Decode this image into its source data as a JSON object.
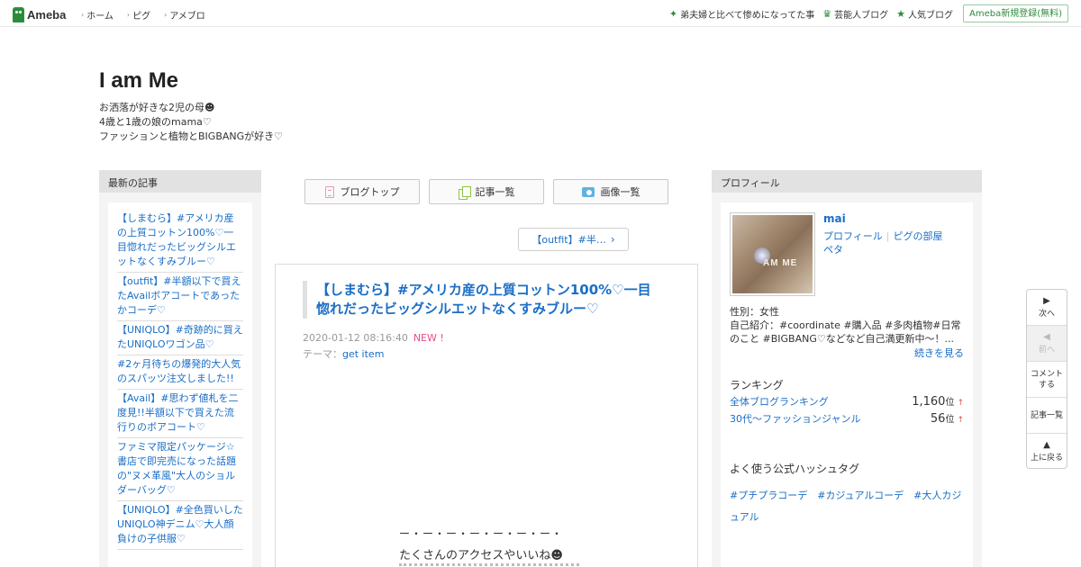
{
  "topbar": {
    "logo_text": "Ameba",
    "links": [
      "ホーム",
      "ピグ",
      "アメブロ"
    ],
    "right_links": [
      {
        "icon": "sparkle-icon",
        "label": "弟夫婦と比べて惨めになってた事"
      },
      {
        "icon": "crown-icon",
        "label": "芸能人ブログ"
      },
      {
        "icon": "star-icon",
        "label": "人気ブログ"
      }
    ],
    "register_label": "Ameba新規登録(無料)"
  },
  "blog": {
    "title": "I am Me",
    "desc_line1": "お洒落が好きな2児の母☻",
    "desc_line2": "4歳と1歳の娘のmama♡",
    "desc_line3": "ファッションと植物とBIGBANGが好き♡"
  },
  "sidebar": {
    "heading": "最新の記事",
    "items": [
      "【しまむら】#アメリカ産の上質コットン100%♡一目惚れだったビッグシルエットなくすみブルー♡",
      "【outfit】#半額以下で買えたAvailボアコートであったかコーデ♡",
      "【UNIQLO】#奇跡的に買えたUNIQLOワゴン品♡",
      "#2ヶ月待ちの爆発的大人気のスパッツ注文しました!!",
      "【Avail】#思わず値札を二度見!!半額以下で買えた流行りのボアコート♡",
      "ファミマ限定パッケージ☆書店で即完売になった話題の\"ヌメ革風\"大人のショルダーバッグ♡",
      "【UNIQLO】#全色買いしたUNIQLO神デニム♡大人顔負けの子供服♡"
    ]
  },
  "nav": {
    "blog_top": "ブログトップ",
    "article_list": "記事一覧",
    "image_list": "画像一覧"
  },
  "prev_article": "【outfit】#半…",
  "article": {
    "title": "【しまむら】#アメリカ産の上質コットン100%♡一目惚れだったビッグシルエットなくすみブルー♡",
    "datetime": "2020-01-12 08:16:40",
    "new_badge": "NEW !",
    "theme_label": "テーマ：",
    "theme_value": "get item",
    "divider": "ー・ー・ー・ー・ー・ー・ー・",
    "body_line1": "たくさんのアクセスやいいね☻"
  },
  "profile": {
    "heading": "プロフィール",
    "avatar_text": "AM ME",
    "name": "mai",
    "link_profile": "プロフィール",
    "link_pig": "ピグの部屋",
    "link_peta": "ペタ",
    "gender": "性別：女性",
    "intro": "自己紹介：#coordinate #購入品 #多肉植物#日常のこと #BIGBANG♡などなど自己満更新中〜！...",
    "more": "続きを見る",
    "ranking_heading": "ランキング",
    "rankings": [
      {
        "label": "全体ブログランキング",
        "value": "1,160",
        "unit": "位",
        "trend": "↑"
      },
      {
        "label": "30代〜ファッションジャンル",
        "value": "56",
        "unit": "位",
        "trend": "↑"
      }
    ],
    "hashtag_heading": "よく使う公式ハッシュタグ",
    "hashtags": [
      "#プチプラコーデ",
      "#カジュアルコーデ",
      "#大人カジュアル"
    ]
  },
  "float_nav": {
    "next": "次へ",
    "prev": "前へ",
    "comment": "コメントする",
    "list": "記事一覧",
    "top": "上に戻る"
  },
  "colors": {
    "brand_green": "#2d8c3c",
    "link_blue": "#1a6ec6",
    "new_pink": "#e84c8b"
  }
}
